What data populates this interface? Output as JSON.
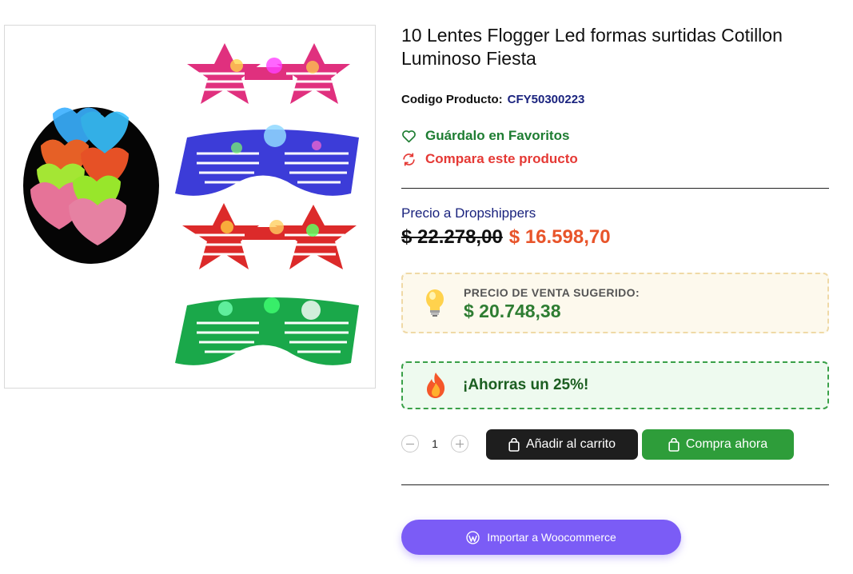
{
  "product": {
    "title": "10 Lentes Flogger Led formas surtidas Cotillon Luminoso Fiesta",
    "image_alt": "Lentes flogger LED de colores",
    "sku_label": "Codigo Producto:",
    "sku_value": "CFY50300223"
  },
  "actions": {
    "favorite_label": "Guárdalo en Favoritos",
    "compare_label": "Compara este producto"
  },
  "pricing": {
    "dropshipper_label": "Precio a Dropshippers",
    "old_price": "$ 22.278,00",
    "new_price": "$ 16.598,70",
    "suggested_label": "PRECIO DE VENTA SUGERIDO:",
    "suggested_price": "$ 20.748,38",
    "savings_text": "¡Ahorras un 25%!"
  },
  "cart": {
    "quantity": "1",
    "add_to_cart_label": "Añadir al carrito",
    "buy_now_label": "Compra ahora"
  },
  "import": {
    "woocommerce_label": "Importar a Woocommerce"
  },
  "colors": {
    "accent_green": "#2e9d3a",
    "price_orange": "#e8542a",
    "navy": "#1a237e",
    "compare_red": "#e53935",
    "woo_purple": "#7b5cf6"
  },
  "icons": {
    "favorite": "heart-icon",
    "compare": "refresh-icon",
    "suggested": "lightbulb-icon",
    "savings": "fire-icon",
    "cart": "shopping-bag-icon",
    "import": "wordpress-icon"
  }
}
